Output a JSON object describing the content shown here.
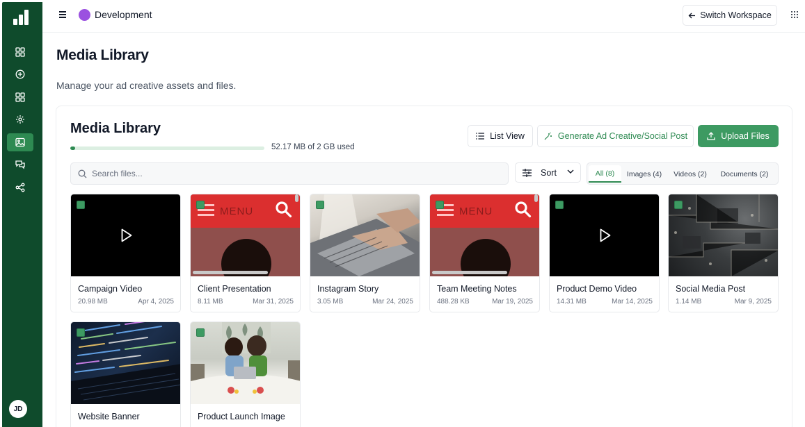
{
  "sidebar": {
    "items": [
      {
        "icon": "dashboard-icon"
      },
      {
        "icon": "add-circle-icon"
      },
      {
        "icon": "grid-icon"
      },
      {
        "icon": "gear-icon"
      },
      {
        "icon": "image-icon",
        "active": true
      },
      {
        "icon": "chat-icon"
      },
      {
        "icon": "share-icon"
      }
    ],
    "user_initials": "JD"
  },
  "topbar": {
    "workspace_name": "Development",
    "workspace_color": "#9b51e0",
    "switch_label": "Switch Workspace"
  },
  "page": {
    "title": "Media Library",
    "subtitle": "Manage your ad creative assets and files."
  },
  "library": {
    "title": "Media Library",
    "storage_text": "52.17 MB of 2 GB used",
    "storage_fraction": 0.025,
    "list_view_label": "List View",
    "generate_label": "Generate Ad Creative/Social Post",
    "upload_label": "Upload Files",
    "search_placeholder": "Search files...",
    "sort_label": "Sort",
    "filters": [
      "All (8)",
      "Images (4)",
      "Videos (2)",
      "Documents (2)"
    ],
    "active_filter": 0
  },
  "media": [
    {
      "name": "Campaign Video",
      "size": "20.98 MB",
      "date": "Apr 4, 2025",
      "kind": "video"
    },
    {
      "name": "Client Presentation",
      "size": "8.11 MB",
      "date": "Mar 31, 2025",
      "kind": "menu"
    },
    {
      "name": "Instagram Story",
      "size": "3.05 MB",
      "date": "Mar 24, 2025",
      "kind": "laptop"
    },
    {
      "name": "Team Meeting Notes",
      "size": "488.28 KB",
      "date": "Mar 19, 2025",
      "kind": "menu"
    },
    {
      "name": "Product Demo Video",
      "size": "14.31 MB",
      "date": "Mar 14, 2025",
      "kind": "video"
    },
    {
      "name": "Social Media Post",
      "size": "1.14 MB",
      "date": "Mar 9, 2025",
      "kind": "circuit"
    },
    {
      "name": "Website Banner",
      "kind": "code"
    },
    {
      "name": "Product Launch Image",
      "kind": "bed"
    }
  ],
  "thumbnail_text": {
    "menu_word": "MENU"
  },
  "colors": {
    "sidebar": "#0f4b2c",
    "accent": "#2e8a52",
    "upload": "#3d9a62"
  }
}
